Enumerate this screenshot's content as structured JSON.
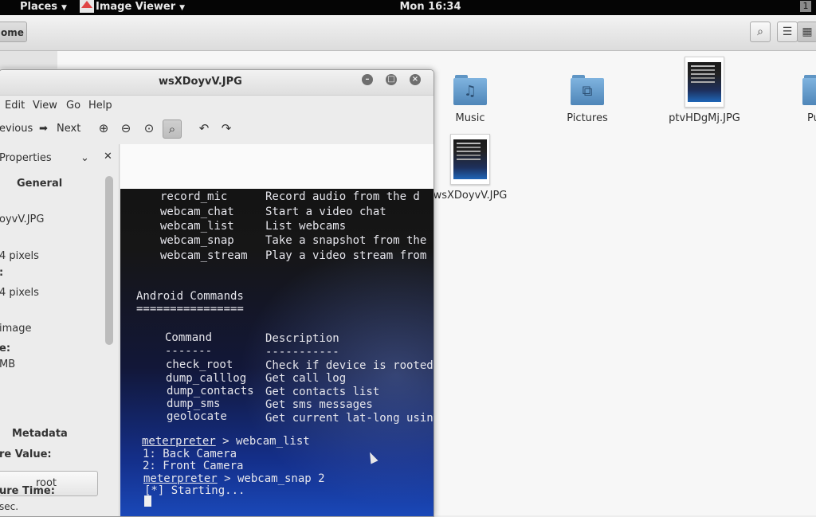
{
  "topbar": {
    "places": "Places",
    "app": "Image Viewer",
    "clock": "Mon 16:34",
    "workspace": "1"
  },
  "fm": {
    "home_label": "ome",
    "items": [
      {
        "name": "Music",
        "kind": "music-folder"
      },
      {
        "name": "Pictures",
        "kind": "pictures-folder"
      },
      {
        "name": "ptvHDgMj.JPG",
        "kind": "image"
      },
      {
        "name": "Pu",
        "kind": "folder"
      },
      {
        "name": "wsXDoyvV.JPG",
        "kind": "image"
      }
    ]
  },
  "viewer": {
    "title": "wsXDoyvV.JPG",
    "menu": [
      "Edit",
      "View",
      "Go",
      "Help"
    ],
    "toolbar": {
      "previous": "evious",
      "next": "Next"
    },
    "properties": {
      "header": "Properties",
      "general": "General",
      "lines": [
        "oyvV.JPG",
        "4 pixels",
        ":",
        "4 pixels",
        " image",
        "e:",
        "MB"
      ],
      "root_button": "root",
      "metadata": "Metadata",
      "meta_lines": [
        "re Value:",
        "ure Time:",
        " sec."
      ]
    }
  },
  "terminal": {
    "lines_top": [
      [
        "record_mic",
        "Record audio from the d"
      ],
      [
        "webcam_chat",
        "Start a video chat"
      ],
      [
        "webcam_list",
        "List webcams"
      ],
      [
        "webcam_snap",
        "Take a snapshot from the"
      ],
      [
        "webcam_stream",
        "Play a video stream from"
      ]
    ],
    "section": "Android Commands",
    "section_rule": "================",
    "col_command": "Command",
    "col_description": "Description",
    "col_command_rule": "-------",
    "col_description_rule": "-----------",
    "rows": [
      [
        "check_root",
        "Check if device is rooted"
      ],
      [
        "dump_calllog",
        "Get call log"
      ],
      [
        "dump_contacts",
        "Get contacts list"
      ],
      [
        "dump_sms",
        "Get sms messages"
      ],
      [
        "geolocate",
        "Get current lat-long usin"
      ]
    ],
    "prompt": "meterpreter",
    "cmd1": " > webcam_list",
    "out1": "1: Back Camera",
    "out2": "2: Front Camera",
    "cmd2": " > webcam_snap 2",
    "out3": "[*] Starting..."
  }
}
